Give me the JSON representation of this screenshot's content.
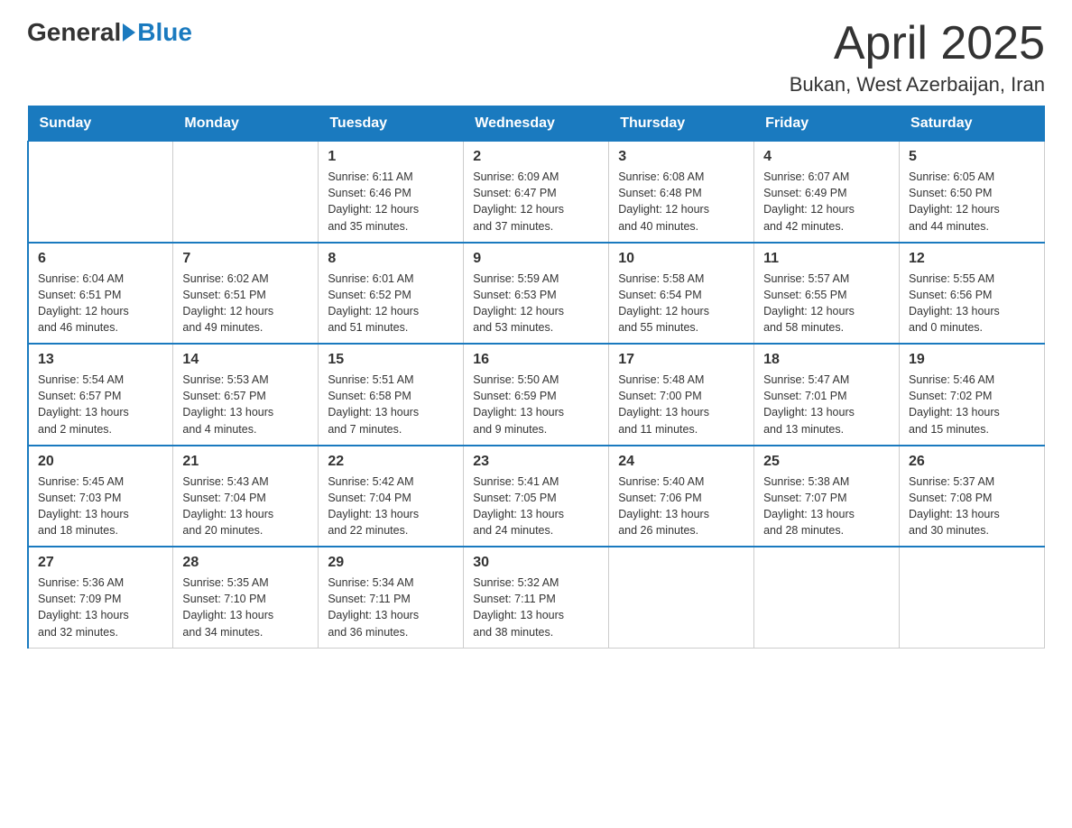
{
  "header": {
    "logo_general": "General",
    "logo_blue": "Blue",
    "month_year": "April 2025",
    "location": "Bukan, West Azerbaijan, Iran"
  },
  "weekdays": [
    "Sunday",
    "Monday",
    "Tuesday",
    "Wednesday",
    "Thursday",
    "Friday",
    "Saturday"
  ],
  "weeks": [
    [
      {
        "day": "",
        "info": ""
      },
      {
        "day": "",
        "info": ""
      },
      {
        "day": "1",
        "info": "Sunrise: 6:11 AM\nSunset: 6:46 PM\nDaylight: 12 hours\nand 35 minutes."
      },
      {
        "day": "2",
        "info": "Sunrise: 6:09 AM\nSunset: 6:47 PM\nDaylight: 12 hours\nand 37 minutes."
      },
      {
        "day": "3",
        "info": "Sunrise: 6:08 AM\nSunset: 6:48 PM\nDaylight: 12 hours\nand 40 minutes."
      },
      {
        "day": "4",
        "info": "Sunrise: 6:07 AM\nSunset: 6:49 PM\nDaylight: 12 hours\nand 42 minutes."
      },
      {
        "day": "5",
        "info": "Sunrise: 6:05 AM\nSunset: 6:50 PM\nDaylight: 12 hours\nand 44 minutes."
      }
    ],
    [
      {
        "day": "6",
        "info": "Sunrise: 6:04 AM\nSunset: 6:51 PM\nDaylight: 12 hours\nand 46 minutes."
      },
      {
        "day": "7",
        "info": "Sunrise: 6:02 AM\nSunset: 6:51 PM\nDaylight: 12 hours\nand 49 minutes."
      },
      {
        "day": "8",
        "info": "Sunrise: 6:01 AM\nSunset: 6:52 PM\nDaylight: 12 hours\nand 51 minutes."
      },
      {
        "day": "9",
        "info": "Sunrise: 5:59 AM\nSunset: 6:53 PM\nDaylight: 12 hours\nand 53 minutes."
      },
      {
        "day": "10",
        "info": "Sunrise: 5:58 AM\nSunset: 6:54 PM\nDaylight: 12 hours\nand 55 minutes."
      },
      {
        "day": "11",
        "info": "Sunrise: 5:57 AM\nSunset: 6:55 PM\nDaylight: 12 hours\nand 58 minutes."
      },
      {
        "day": "12",
        "info": "Sunrise: 5:55 AM\nSunset: 6:56 PM\nDaylight: 13 hours\nand 0 minutes."
      }
    ],
    [
      {
        "day": "13",
        "info": "Sunrise: 5:54 AM\nSunset: 6:57 PM\nDaylight: 13 hours\nand 2 minutes."
      },
      {
        "day": "14",
        "info": "Sunrise: 5:53 AM\nSunset: 6:57 PM\nDaylight: 13 hours\nand 4 minutes."
      },
      {
        "day": "15",
        "info": "Sunrise: 5:51 AM\nSunset: 6:58 PM\nDaylight: 13 hours\nand 7 minutes."
      },
      {
        "day": "16",
        "info": "Sunrise: 5:50 AM\nSunset: 6:59 PM\nDaylight: 13 hours\nand 9 minutes."
      },
      {
        "day": "17",
        "info": "Sunrise: 5:48 AM\nSunset: 7:00 PM\nDaylight: 13 hours\nand 11 minutes."
      },
      {
        "day": "18",
        "info": "Sunrise: 5:47 AM\nSunset: 7:01 PM\nDaylight: 13 hours\nand 13 minutes."
      },
      {
        "day": "19",
        "info": "Sunrise: 5:46 AM\nSunset: 7:02 PM\nDaylight: 13 hours\nand 15 minutes."
      }
    ],
    [
      {
        "day": "20",
        "info": "Sunrise: 5:45 AM\nSunset: 7:03 PM\nDaylight: 13 hours\nand 18 minutes."
      },
      {
        "day": "21",
        "info": "Sunrise: 5:43 AM\nSunset: 7:04 PM\nDaylight: 13 hours\nand 20 minutes."
      },
      {
        "day": "22",
        "info": "Sunrise: 5:42 AM\nSunset: 7:04 PM\nDaylight: 13 hours\nand 22 minutes."
      },
      {
        "day": "23",
        "info": "Sunrise: 5:41 AM\nSunset: 7:05 PM\nDaylight: 13 hours\nand 24 minutes."
      },
      {
        "day": "24",
        "info": "Sunrise: 5:40 AM\nSunset: 7:06 PM\nDaylight: 13 hours\nand 26 minutes."
      },
      {
        "day": "25",
        "info": "Sunrise: 5:38 AM\nSunset: 7:07 PM\nDaylight: 13 hours\nand 28 minutes."
      },
      {
        "day": "26",
        "info": "Sunrise: 5:37 AM\nSunset: 7:08 PM\nDaylight: 13 hours\nand 30 minutes."
      }
    ],
    [
      {
        "day": "27",
        "info": "Sunrise: 5:36 AM\nSunset: 7:09 PM\nDaylight: 13 hours\nand 32 minutes."
      },
      {
        "day": "28",
        "info": "Sunrise: 5:35 AM\nSunset: 7:10 PM\nDaylight: 13 hours\nand 34 minutes."
      },
      {
        "day": "29",
        "info": "Sunrise: 5:34 AM\nSunset: 7:11 PM\nDaylight: 13 hours\nand 36 minutes."
      },
      {
        "day": "30",
        "info": "Sunrise: 5:32 AM\nSunset: 7:11 PM\nDaylight: 13 hours\nand 38 minutes."
      },
      {
        "day": "",
        "info": ""
      },
      {
        "day": "",
        "info": ""
      },
      {
        "day": "",
        "info": ""
      }
    ]
  ]
}
